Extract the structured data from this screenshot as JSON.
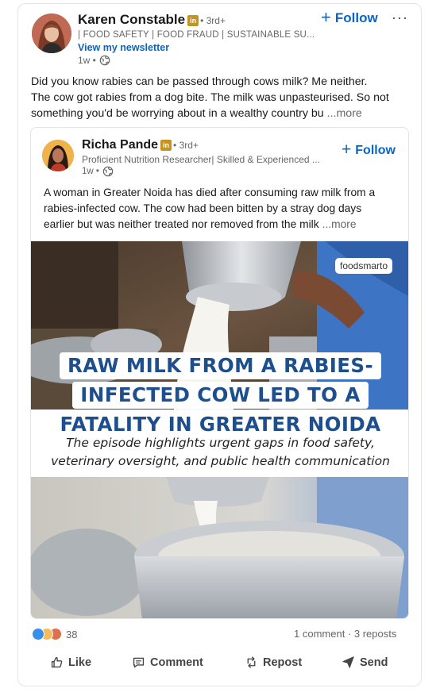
{
  "post": {
    "author": {
      "name": "Karen Constable",
      "badge": "in",
      "degree": "• 3rd+",
      "headline": "| FOOD SAFETY | FOOD FRAUD | SUSTAINABLE SU...",
      "newsletter_link": "View my newsletter",
      "time": "1w •"
    },
    "follow_label": "Follow",
    "more_menu": "···",
    "text_lines": [
      "Did you know rabies can be passed through cows milk? Me neither.",
      "The cow got rabies from a dog bite. The milk was unpasteurised. So not",
      "something you'd be worrying about in a wealthy country bu"
    ],
    "more_label": "...more"
  },
  "shared": {
    "author": {
      "name": "Richa Pande",
      "badge": "in",
      "degree": "• 3rd+",
      "headline": "Proficient Nutrition Researcher| Skilled & Experienced ...",
      "time": "1w •"
    },
    "follow_label": "Follow",
    "text_lines": [
      "A woman in Greater Noida has died after consuming raw milk from a",
      "rabies-infected cow. The cow had been bitten by a stray dog days",
      "earlier but was neither treated nor removed from the milk"
    ],
    "more_label": "...more",
    "image": {
      "watermark": "foodsmarto",
      "headline_lines": [
        "RAW MILK FROM A RABIES-",
        "INFECTED COW LED TO A",
        "FATALITY IN GREATER NOIDA"
      ],
      "subtitle_lines": [
        "The episode highlights urgent gaps in food safety,",
        "veterinary oversight, and public health communication"
      ]
    }
  },
  "social": {
    "reaction_count": "38",
    "comments_reposts": "1 comment · 3 reposts"
  },
  "actions": {
    "like": "Like",
    "comment": "Comment",
    "repost": "Repost",
    "send": "Send"
  },
  "colors": {
    "link_blue": "#0a66c2",
    "headline_blue": "#1d4f8e",
    "badge_gold": "#c5941f"
  }
}
